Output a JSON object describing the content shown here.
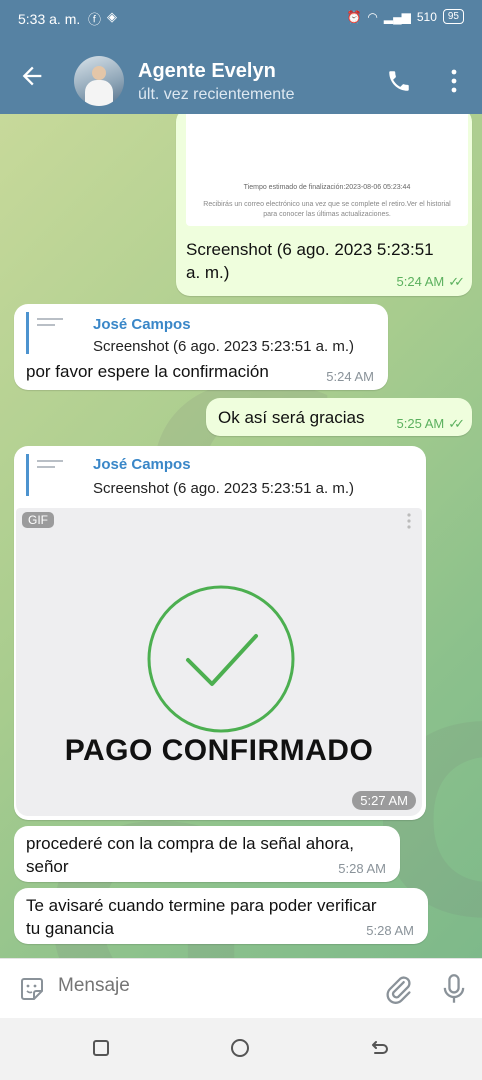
{
  "status_bar": {
    "time": "5:33 a. m.",
    "signal_speed": "510",
    "battery": "95"
  },
  "header": {
    "contact_name": "Agente Evelyn",
    "contact_status": "últ. vez recientemente"
  },
  "messages": [
    {
      "id": "m1",
      "direction": "outgoing",
      "type": "screenshot",
      "screenshot_line1": "Tiempo estimado de finalización:2023-08-06 05:23:44",
      "screenshot_line2": "Recibirás un correo electrónico una vez que se complete el retiro.Ver el historial para conocer las últimas actualizaciones.",
      "caption_line1": "Screenshot (6 ago. 2023 5:23:51",
      "caption_line2": "a. m.)",
      "time": "5:24 AM",
      "ticks": "✓✓"
    },
    {
      "id": "m2",
      "direction": "incoming",
      "type": "reply",
      "quote_name": "José Campos",
      "quote_text": "Screenshot (6 ago. 2023 5:23:51 a. m.)",
      "text": "por favor espere la confirmación",
      "time": "5:24 AM"
    },
    {
      "id": "m3",
      "direction": "outgoing",
      "type": "text",
      "text": "Ok así será gracias",
      "time": "5:25 AM",
      "ticks": "✓✓"
    },
    {
      "id": "m4",
      "direction": "incoming",
      "type": "gif-reply",
      "quote_name": "José Campos",
      "quote_text": "Screenshot (6 ago. 2023 5:23:51 a. m.)",
      "gif_tag": "GIF",
      "gif_title": "PAGO CONFIRMADO",
      "time": "5:27 AM"
    },
    {
      "id": "m5",
      "direction": "incoming",
      "type": "text",
      "text_line1": "procederé con la compra de la señal ahora,",
      "text_line2": "señor",
      "time": "5:28 AM"
    },
    {
      "id": "m6",
      "direction": "incoming",
      "type": "text",
      "text_line1": "Te avisaré cuando termine para poder verificar",
      "text_line2": "tu ganancia",
      "time": "5:28 AM"
    }
  ],
  "composer": {
    "placeholder": "Mensaje"
  },
  "colors": {
    "header": "#5682a3",
    "outgoing_bubble": "#effedd",
    "incoming_bubble": "#ffffff",
    "check_green": "#4caf50",
    "link_blue": "#3a87c8"
  },
  "icons": [
    "back-arrow-icon",
    "phone-icon",
    "more-vert-icon",
    "sticker-icon",
    "paperclip-icon",
    "microphone-icon",
    "nav-recents-icon",
    "nav-home-icon",
    "nav-back-icon",
    "checkmark-circle-icon"
  ]
}
